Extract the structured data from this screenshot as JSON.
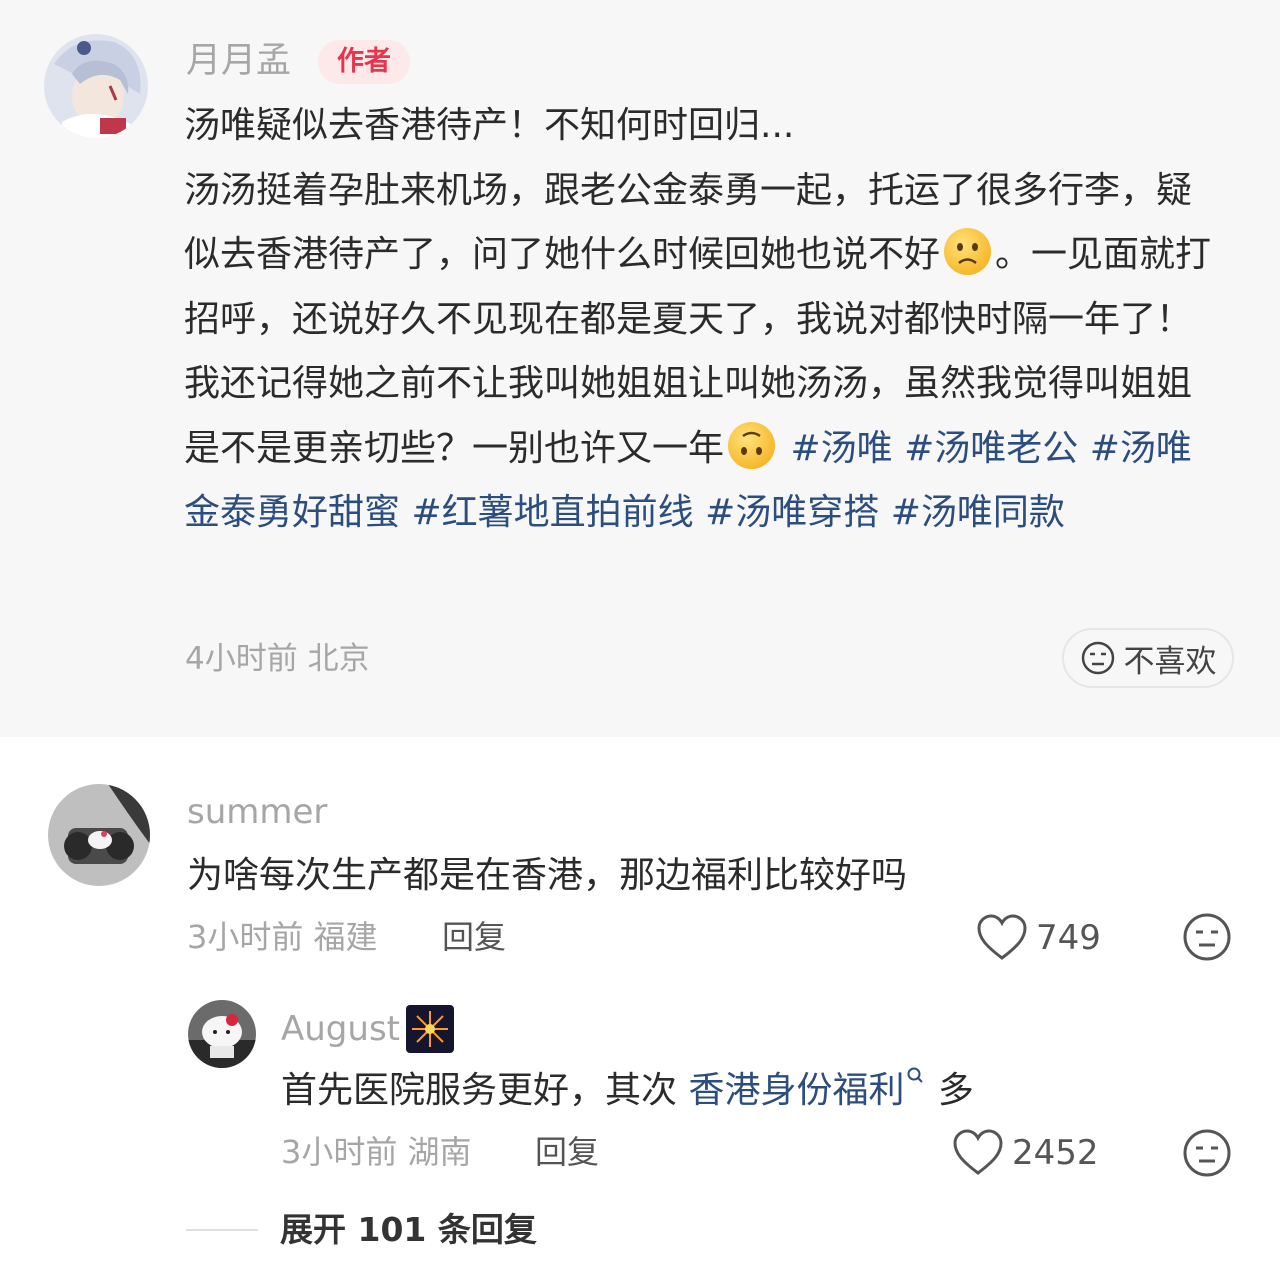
{
  "post": {
    "author": "月月孟",
    "badge": "作者",
    "lines": [
      "汤唯疑似去香港待产！不知何时回归...",
      "汤汤挺着孕肚来机场，跟老公金泰勇一起，托运了很多行李，疑似去香港待产了，问了她什么时候回她也说不好",
      "。一见面就打招呼，还说好久不见现在都是夏天了，我说对都快时隔一年了！我还记得她之前不让我叫她姐姐让叫她汤汤，虽然我觉得叫姐姐是不是更亲切些？一别也许又一年"
    ],
    "tags": [
      "#汤唯",
      "#汤唯老公",
      "#汤唯金泰勇好甜蜜",
      "#红薯地直拍前线",
      "#汤唯穿搭",
      "#汤唯同款"
    ],
    "meta": "4小时前 北京",
    "dislike_label": "不喜欢",
    "emoji_1": "sad-face",
    "emoji_2": "upside-down-face"
  },
  "comments": [
    {
      "user": "summer",
      "text": "为啥每次生产都是在香港，那边福利比较好吗",
      "meta": "3小时前 福建",
      "reply_label": "回复",
      "likes": "749"
    },
    {
      "user": "August",
      "text_before": "首先医院服务更好，其次 ",
      "link": "香港身份福利",
      "text_after": " 多",
      "meta": "3小时前 湖南",
      "reply_label": "回复",
      "likes": "2452"
    }
  ],
  "expand_label": "展开 101 条回复",
  "colors": {
    "link": "#2c4e7e",
    "badge_text": "#e8344c",
    "badge_bg": "#fde8ea",
    "muted": "#a6a6a6"
  }
}
